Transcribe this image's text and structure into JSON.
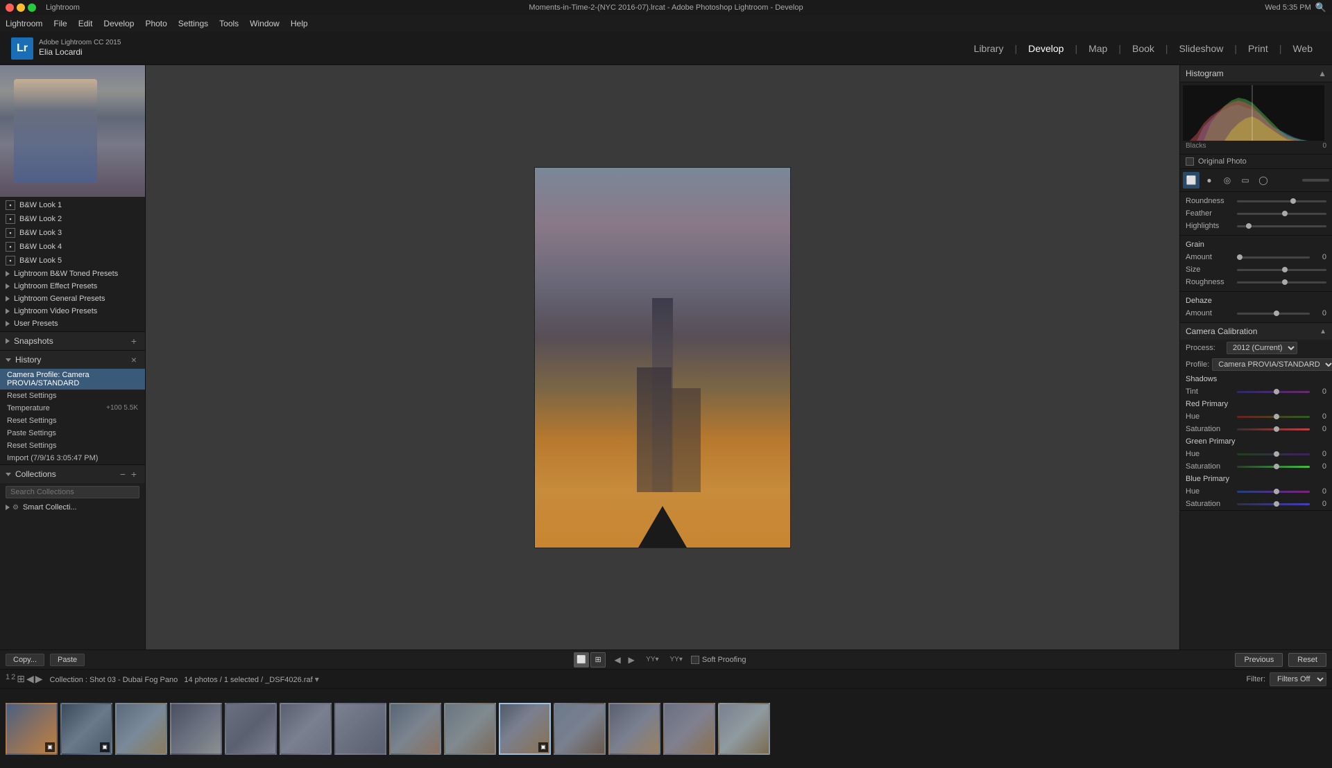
{
  "window": {
    "title": "Moments-in-Time-2-(NYC 2016-07).lrcat - Adobe Photoshop Lightroom - Develop",
    "traffic_lights": [
      "close",
      "minimize",
      "maximize"
    ]
  },
  "menubar": {
    "items": [
      "Lightroom",
      "File",
      "Edit",
      "Develop",
      "Photo",
      "Settings",
      "Tools",
      "Window",
      "Help"
    ]
  },
  "header": {
    "app_version": "Adobe Lightroom CC 2015",
    "user_name": "Elia Locardi",
    "lr_label": "Lr",
    "nav_tabs": [
      "Library",
      "Develop",
      "Map",
      "Book",
      "Slideshow",
      "Print",
      "Web"
    ]
  },
  "left_panel": {
    "presets": {
      "items": [
        {
          "label": "B&W Look 1",
          "type": "file"
        },
        {
          "label": "B&W Look 2",
          "type": "file"
        },
        {
          "label": "B&W Look 3",
          "type": "file"
        },
        {
          "label": "B&W Look 4",
          "type": "file"
        },
        {
          "label": "B&W Look 5",
          "type": "file"
        },
        {
          "label": "Lightroom B&W Toned Presets",
          "type": "group"
        },
        {
          "label": "Lightroom Effect Presets",
          "type": "group"
        },
        {
          "label": "Lightroom General Presets",
          "type": "group"
        },
        {
          "label": "Lightroom Video Presets",
          "type": "group"
        },
        {
          "label": "User Presets",
          "type": "group"
        }
      ]
    },
    "snapshots": {
      "title": "Snapshots",
      "add_icon": "+"
    },
    "history": {
      "title": "History",
      "close_icon": "×",
      "items": [
        {
          "label": "Camera Profile: Camera PROVIA/STANDARD",
          "active": true
        },
        {
          "label": "Reset Settings"
        },
        {
          "label": "Temperature",
          "value1": "+100",
          "value2": "5.5K"
        },
        {
          "label": "Reset Settings"
        },
        {
          "label": "Paste Settings"
        },
        {
          "label": "Reset Settings"
        },
        {
          "label": "Import (7/9/16 3:05:47 PM)"
        }
      ]
    },
    "collections": {
      "title": "Collections",
      "minus_icon": "−",
      "plus_icon": "+",
      "search_placeholder": "Search Collections",
      "items": [
        {
          "label": "Smart Collecti...",
          "type": "smart"
        }
      ]
    }
  },
  "bottom_toolbar": {
    "copy_label": "Copy...",
    "paste_label": "Paste",
    "soft_proofing_label": "Soft Proofing",
    "previous_label": "Previous",
    "reset_label": "Reset"
  },
  "filmstrip_bar": {
    "page_numbers": [
      "1",
      "2"
    ],
    "collection_name": "Collection : Shot 03 - Dubai Fog Pano",
    "photos_info": "14 photos / 1 selected / _DSF4026.raf",
    "filter_label": "Filter:",
    "filter_options": [
      "Filters Off"
    ]
  },
  "filmstrip": {
    "thumbs": [
      {
        "id": 1,
        "class": "t1",
        "badge": true
      },
      {
        "id": 2,
        "class": "t2",
        "badge": true
      },
      {
        "id": 3,
        "class": "t3"
      },
      {
        "id": 4,
        "class": "t4"
      },
      {
        "id": 5,
        "class": "t5"
      },
      {
        "id": 6,
        "class": "t6"
      },
      {
        "id": 7,
        "class": "t7"
      },
      {
        "id": 8,
        "class": "t8"
      },
      {
        "id": 9,
        "class": "t9"
      },
      {
        "id": 10,
        "class": "t10",
        "selected": true,
        "badge": true
      },
      {
        "id": 11,
        "class": "t11"
      },
      {
        "id": 12,
        "class": "t12"
      },
      {
        "id": 13,
        "class": "t13"
      },
      {
        "id": 14,
        "class": "t14"
      }
    ]
  },
  "right_panel": {
    "histogram": {
      "title": "Histogram",
      "blacks_label": "Blacks",
      "blacks_value": "0"
    },
    "tools": {
      "original_photo": "Original Photo"
    },
    "transform": {
      "roundness_label": "Roundness",
      "feather_label": "Feather",
      "highlights_label": "Highlights"
    },
    "grain": {
      "title": "Grain",
      "amount_label": "Amount",
      "amount_value": "0",
      "size_label": "Size",
      "roughness_label": "Roughness"
    },
    "dehaze": {
      "title": "Dehaze",
      "amount_label": "Amount",
      "amount_value": "0"
    },
    "camera_calibration": {
      "title": "Camera Calibration",
      "process_label": "Process:",
      "process_value": "2012 (Current)",
      "profile_label": "Profile:",
      "profile_value": "Camera PROVIA/STANDARD",
      "shadows_label": "Shadows",
      "shadows_tint_label": "Tint",
      "shadows_tint_value": "0",
      "red_primary_label": "Red Primary",
      "red_hue_label": "Hue",
      "red_hue_value": "0",
      "red_sat_label": "Saturation",
      "red_sat_value": "0",
      "green_primary_label": "Green Primary",
      "green_hue_label": "Hue",
      "green_hue_value": "0",
      "green_sat_label": "Saturation",
      "green_sat_value": "0",
      "blue_primary_label": "Blue Primary",
      "blue_hue_label": "Hue",
      "blue_hue_value": "0",
      "blue_sat_label": "Saturation",
      "blue_sat_value": "0"
    }
  }
}
